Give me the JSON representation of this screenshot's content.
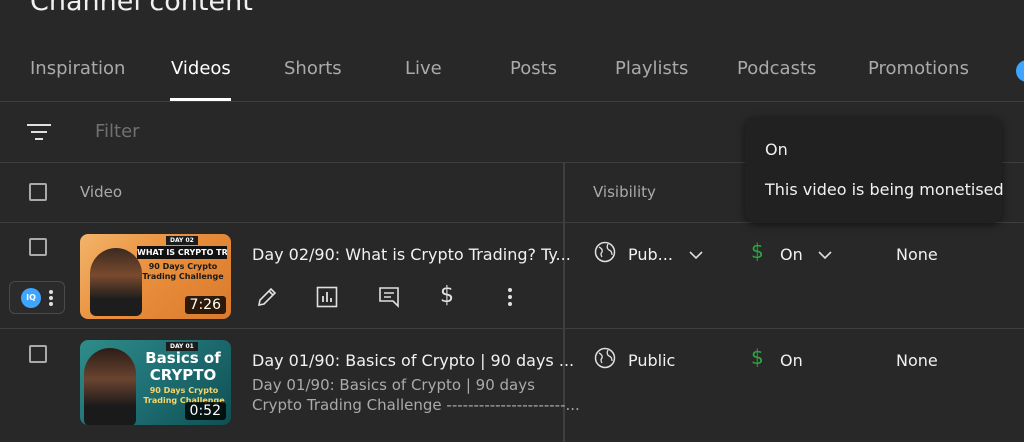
{
  "header": {
    "title": "Channel content"
  },
  "tabs": [
    {
      "label": "Inspiration"
    },
    {
      "label": "Videos"
    },
    {
      "label": "Shorts"
    },
    {
      "label": "Live"
    },
    {
      "label": "Posts"
    },
    {
      "label": "Playlists"
    },
    {
      "label": "Podcasts"
    },
    {
      "label": "Promotions"
    }
  ],
  "filter": {
    "placeholder": "Filter"
  },
  "table": {
    "headers": {
      "video": "Video",
      "visibility": "Visibility"
    }
  },
  "rows": [
    {
      "title": "Day 02/90: What is Crypto Trading? Ty...",
      "duration": "7:26",
      "thumb": {
        "day": "DAY 02",
        "headline": "WHAT IS CRYPTO TRADING",
        "sub": "90 Days Crypto Trading Challenge"
      },
      "visibility": "Pub...",
      "monetization": "On",
      "restrictions": "None"
    },
    {
      "title": "Day 01/90: Basics of Crypto | 90 days ...",
      "description_line1": "Day 01/90: Basics of Crypto | 90 days",
      "description_line2": "Crypto Trading Challenge ----------------------...",
      "duration": "0:52",
      "thumb": {
        "day": "DAY 01",
        "headline1": "Basics of",
        "headline2": "CRYPTO",
        "sub": "90 Days Crypto Trading Challenge"
      },
      "visibility": "Public",
      "monetization": "On",
      "restrictions": "None"
    }
  ],
  "tooltip": {
    "title": "On",
    "body": "This video is being monetised"
  },
  "extension": {
    "label": "IQ"
  },
  "colors": {
    "background": "#282828",
    "accent_green": "#2ba640",
    "extension_blue": "#3ea6ff"
  }
}
